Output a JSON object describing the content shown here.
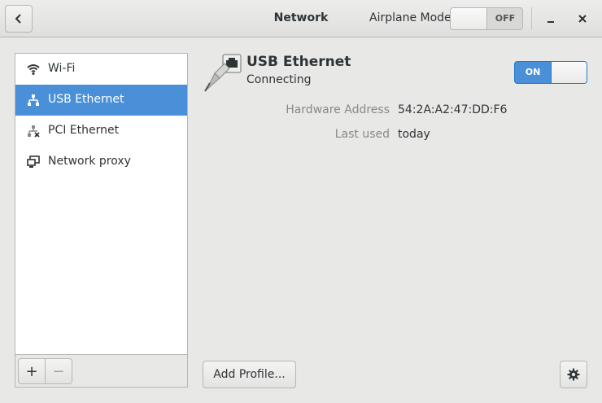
{
  "header": {
    "title": "Network",
    "airplane_label": "Airplane Mode",
    "airplane_state": "OFF"
  },
  "sidebar": {
    "items": [
      {
        "label": "Wi-Fi",
        "icon": "wifi-icon"
      },
      {
        "label": "USB Ethernet",
        "icon": "wired-network-icon",
        "selected": true
      },
      {
        "label": "PCI Ethernet",
        "icon": "wired-network-disconnected-icon"
      },
      {
        "label": "Network proxy",
        "icon": "network-proxy-icon"
      }
    ],
    "toolbar": {
      "add_label": "+",
      "remove_label": "−"
    }
  },
  "device": {
    "name": "USB Ethernet",
    "status": "Connecting",
    "switch_state": "ON",
    "details": [
      {
        "label": "Hardware Address",
        "value": "54:2A:A2:47:DD:F6"
      },
      {
        "label": "Last used",
        "value": "today"
      }
    ]
  },
  "actions": {
    "add_profile_label": "Add Profile..."
  },
  "colors": {
    "accent": "#4a90d9",
    "background": "#e8e8e7"
  }
}
